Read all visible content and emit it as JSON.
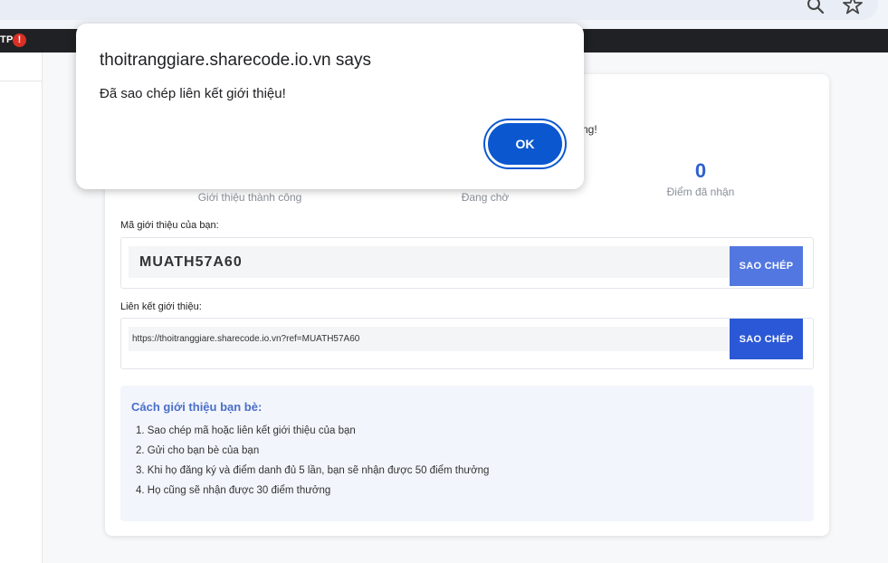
{
  "browser": {
    "search_icon": "search-icon",
    "star_icon": "star-icon",
    "bookmark_label": "TP",
    "bookmark_badge": "!"
  },
  "referral": {
    "partial_message": "ng!",
    "stats": [
      {
        "value": "",
        "label": "Giới thiệu thành công"
      },
      {
        "value": "",
        "label": "Đang chờ"
      },
      {
        "value": "0",
        "label": "Điểm đã nhận"
      }
    ],
    "code_label": "Mã giới thiệu của bạn:",
    "code_value": "MUATH57A60",
    "link_label": "Liên kết giới thiệu:",
    "link_value": "https://thoitranggiare.sharecode.io.vn?ref=MUATH57A60",
    "copy_label": "SAO CHÉP",
    "howto_title": "Cách giới thiệu bạn bè:",
    "howto_steps": [
      "1. Sao chép mã hoặc liên kết giới thiệu của bạn",
      "2. Gửi cho bạn bè của bạn",
      "3. Khi họ đăng ký và điểm danh đủ 5 lần, bạn sẽ nhận được 50 điểm thưởng",
      "4. Họ cũng sẽ nhận được 30 điểm thưởng"
    ]
  },
  "dialog": {
    "title": "thoitranggiare.sharecode.io.vn says",
    "message": "Đã sao chép liên kết giới thiệu!",
    "ok_label": "OK"
  },
  "colors": {
    "accent": "#2b58d6",
    "dialog_button": "#0b57d0",
    "stat_value": "#2f5fd0",
    "howto_title": "#4a6fc9"
  }
}
